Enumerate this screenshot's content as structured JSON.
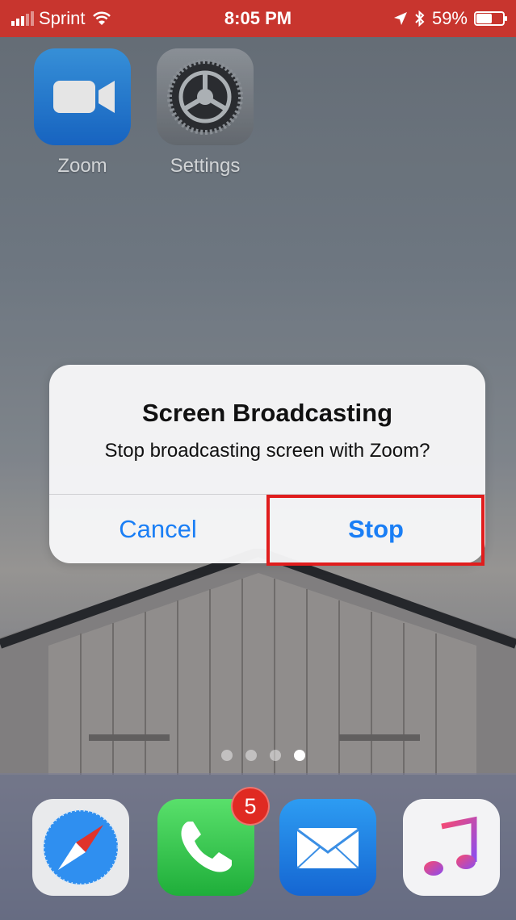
{
  "status_bar": {
    "carrier": "Sprint",
    "time": "8:05 PM",
    "battery_percent": "59%",
    "battery_level": 0.59
  },
  "home": {
    "apps": [
      {
        "label": "Zoom",
        "icon": "zoom-video-icon"
      },
      {
        "label": "Settings",
        "icon": "settings-gear-icon"
      }
    ]
  },
  "alert": {
    "title": "Screen Broadcasting",
    "message": "Stop broadcasting screen with Zoom?",
    "cancel_label": "Cancel",
    "stop_label": "Stop",
    "button_color": "#1a7ef5",
    "highlight_color": "#e01d1d"
  },
  "page_indicator": {
    "pages": 4,
    "active": 4
  },
  "dock": {
    "apps": [
      {
        "icon": "safari-compass-icon"
      },
      {
        "icon": "phone-icon",
        "badge": "5"
      },
      {
        "icon": "mail-envelope-icon"
      },
      {
        "icon": "music-note-icon"
      }
    ]
  }
}
